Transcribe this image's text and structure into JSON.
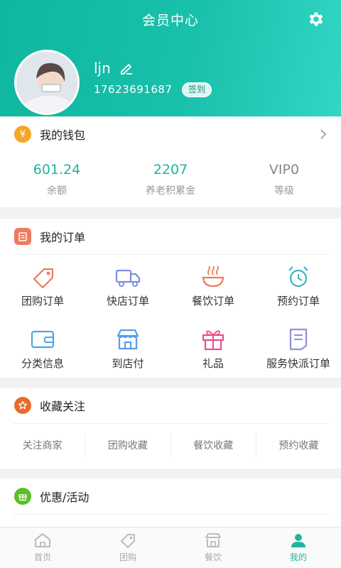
{
  "header": {
    "title": "会员中心"
  },
  "profile": {
    "username": "ljn",
    "phone": "17623691687",
    "signin_label": "签到"
  },
  "wallet": {
    "title": "我的钱包",
    "icon_char": "¥",
    "stats": [
      {
        "value": "601.24",
        "label": "余额"
      },
      {
        "value": "2207",
        "label": "养老积累金"
      },
      {
        "value": "VIP0",
        "label": "等级"
      }
    ]
  },
  "orders": {
    "title": "我的订单",
    "items": [
      {
        "label": "团购订单",
        "icon": "tag-icon",
        "color": "#f07a5a"
      },
      {
        "label": "快店订单",
        "icon": "truck-icon",
        "color": "#7b8fe0"
      },
      {
        "label": "餐饮订单",
        "icon": "bowl-icon",
        "color": "#f07a5a"
      },
      {
        "label": "预约订单",
        "icon": "alarm-clock-icon",
        "color": "#3ab4c8"
      },
      {
        "label": "分类信息",
        "icon": "wallet-card-icon",
        "color": "#4aa8e0"
      },
      {
        "label": "到店付",
        "icon": "store-icon",
        "color": "#5b9be8"
      },
      {
        "label": "礼品",
        "icon": "gift-icon",
        "color": "#e8508a"
      },
      {
        "label": "服务快派订单",
        "icon": "document-icon",
        "color": "#8f8fd8"
      }
    ]
  },
  "favorites": {
    "title": "收藏关注",
    "items": [
      "关注商家",
      "团购收藏",
      "餐饮收藏",
      "预约收藏"
    ]
  },
  "promo": {
    "title": "优惠/活动"
  },
  "tabbar": {
    "tabs": [
      {
        "label": "首页",
        "icon": "home-icon"
      },
      {
        "label": "团购",
        "icon": "tag-icon"
      },
      {
        "label": "餐饮",
        "icon": "store-icon"
      },
      {
        "label": "我的",
        "icon": "user-icon",
        "active": true
      }
    ]
  },
  "colors": {
    "accent": "#1fb5a0",
    "wallet_icon": "#f5a623",
    "orders_icon": "#f07a5a",
    "favorites_icon": "#e86b2a",
    "promo_icon": "#5cbf2a"
  }
}
